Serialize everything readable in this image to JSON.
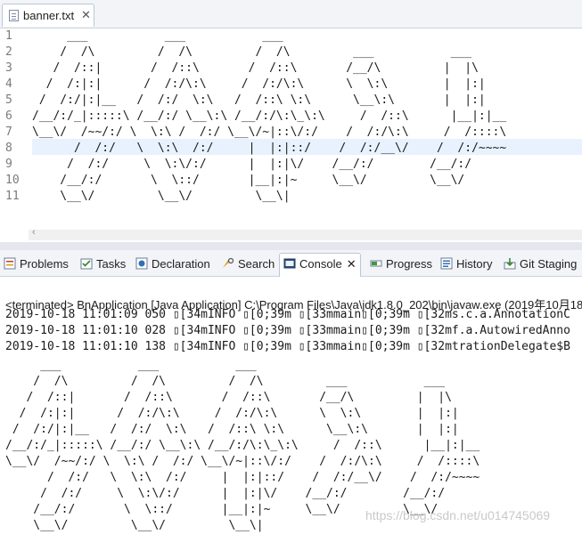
{
  "editor": {
    "tab_label": "banner.txt",
    "close_glyph": "✕",
    "line_numbers": [
      "1",
      "2",
      "3",
      "4",
      "5",
      "6",
      "7",
      "8",
      "9",
      "10",
      "11"
    ],
    "lines": [
      "     ___           ___           ___",
      "    /  /\\         /  /\\         /  /\\         ___           ___",
      "   /  /::|       /  /::\\       /  /::\\       /__/\\         |  |\\",
      "  /  /:|:|      /  /:/\\:\\     /  /:/\\:\\      \\  \\:\\        |  |:|",
      " /  /:/|:|__   /  /:/  \\:\\   /  /::\\ \\:\\      \\__\\:\\       |  |:|",
      "/__/:/_|:::::\\ /__/:/ \\__\\:\\ /__/:/\\:\\_\\:\\     /  /::\\      |__|:|__",
      "\\__\\/  /~~/:/ \\  \\:\\ /  /:/ \\__\\/~|::\\/:/    /  /:/\\:\\     /  /::::\\",
      "      /  /:/   \\  \\:\\  /:/     |  |:|::/    /  /:/__\\/    /  /:/~~~~",
      "     /  /:/     \\  \\:\\/:/      |  |:|\\/    /__/:/        /__/:/",
      "    /__/:/       \\  \\::/       |__|:|~     \\__\\/         \\__\\/",
      "    \\__\\/         \\__\\/         \\__\\|"
    ],
    "scroll_left_glyph": "‹"
  },
  "bottom_tabs": [
    {
      "label": "Problems",
      "icon": "problems-icon"
    },
    {
      "label": "Tasks",
      "icon": "tasks-icon"
    },
    {
      "label": "Declaration",
      "icon": "declaration-icon"
    },
    {
      "label": "Search",
      "icon": "search-icon"
    },
    {
      "label": "Console",
      "icon": "console-icon",
      "close": "✕"
    },
    {
      "label": "Progress",
      "icon": "progress-icon"
    },
    {
      "label": "History",
      "icon": "history-icon"
    },
    {
      "label": "Git Staging",
      "icon": "git-staging-icon"
    }
  ],
  "console": {
    "header": "<terminated> BnApplication [Java Application] C:\\Program Files\\Java\\jdk1.8.0_202\\bin\\javaw.exe (2019年10月18",
    "log_lines": [
      "2019-10-18 11:01:09 050 ▯[34mINFO ▯[0;39m ▯[33mmain▯[0;39m ▯[32ms.c.a.AnnotationC",
      "2019-10-18 11:01:10 028 ▯[34mINFO ▯[0;39m ▯[33mmain▯[0;39m ▯[32mf.a.AutowiredAnno",
      "2019-10-18 11:01:10 138 ▯[34mINFO ▯[0;39m ▯[33mmain▯[0;39m ▯[32mtrationDelegate$B"
    ],
    "banner_lines": [
      "     ___           ___           ___",
      "    /  /\\         /  /\\         /  /\\         ___           ___",
      "   /  /::|       /  /::\\       /  /::\\       /__/\\         |  |\\",
      "  /  /:|:|      /  /:/\\:\\     /  /:/\\:\\      \\  \\:\\        |  |:|",
      " /  /:/|:|__   /  /:/  \\:\\   /  /::\\ \\:\\      \\__\\:\\       |  |:|",
      "/__/:/_|:::::\\ /__/:/ \\__\\:\\ /__/:/\\:\\_\\:\\     /  /::\\      |__|:|__",
      "\\__\\/  /~~/:/ \\  \\:\\ /  /:/ \\__\\/~|::\\/:/    /  /:/\\:\\     /  /::::\\",
      "      /  /:/   \\  \\:\\  /:/     |  |:|::/    /  /:/__\\/    /  /:/~~~~",
      "     /  /:/     \\  \\:\\/:/      |  |:|\\/    /__/:/        /__/:/",
      "    /__/:/       \\  \\::/       |__|:|~     \\__\\/         \\__\\/",
      "    \\__\\/         \\__\\/         \\__\\|"
    ],
    "watermark": "https://blog.csdn.net/u014745069"
  },
  "colors": {
    "tabbar_bg": "#f2f4f7",
    "current_line": "#e8f2fe",
    "line_number": "#7b7b7b"
  }
}
